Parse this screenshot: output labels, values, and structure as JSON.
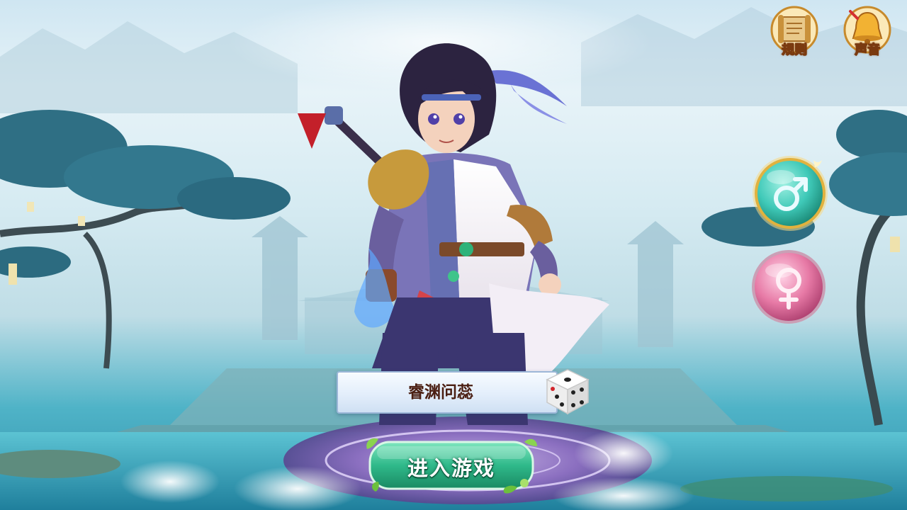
{
  "header": {
    "rules_label": "规则",
    "sound_label": "声音"
  },
  "gender": {
    "male_symbol": "♂",
    "female_symbol": "♀",
    "selected": "male"
  },
  "character": {
    "name": "睿渊问蕊"
  },
  "actions": {
    "enter_label": "进入游戏"
  },
  "colors": {
    "male_orb": "#3fc9b8",
    "female_orb": "#e77aa6",
    "enter_button": "#2fb98a",
    "name_text": "#4a1e12"
  },
  "icons": {
    "rules": "scroll-icon",
    "sound": "bell-icon",
    "random": "dice-icon"
  }
}
